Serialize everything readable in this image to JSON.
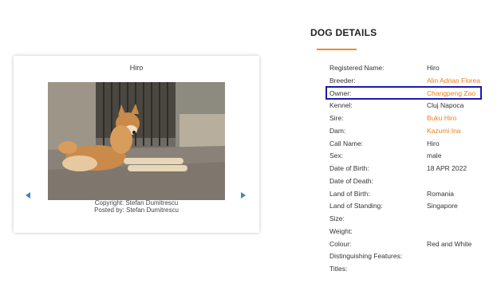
{
  "card": {
    "title": "Hiro",
    "caption_copyright": "Copyright: Stefan Dumitrescu",
    "caption_posted": "Posted by: Stefan Dumitrescu"
  },
  "details": {
    "heading": "DOG DETAILS",
    "rows": [
      {
        "label": "Registered Name:",
        "value": "Hiro",
        "link": false
      },
      {
        "label": "Breeder:",
        "value": "Alin Adrian Florea",
        "link": true
      },
      {
        "label": "Owner:",
        "value": "Changpeng Zao",
        "link": true
      },
      {
        "label": "Kennel:",
        "value": "Cluj Napoca",
        "link": false
      },
      {
        "label": "Sire:",
        "value": "Buku Hiro",
        "link": true
      },
      {
        "label": "Dam:",
        "value": "Kazumi Ina",
        "link": true
      },
      {
        "label": "Call Name:",
        "value": "Hiro",
        "link": false
      },
      {
        "label": "Sex:",
        "value": "male",
        "link": false
      },
      {
        "label": "Date of Birth:",
        "value": "18 APR 2022",
        "link": false
      },
      {
        "label": "Date of Death:",
        "value": "",
        "link": false
      },
      {
        "label": "Land of Birth:",
        "value": "Romania",
        "link": false
      },
      {
        "label": "Land of Standing:",
        "value": "Singapore",
        "link": false
      },
      {
        "label": "Size:",
        "value": "",
        "link": false
      },
      {
        "label": "Weight:",
        "value": "",
        "link": false
      },
      {
        "label": "Colour:",
        "value": "Red and White",
        "link": false
      },
      {
        "label": "Distinguishing Features:",
        "value": "",
        "link": false
      },
      {
        "label": "Titles:",
        "value": "",
        "link": false
      }
    ]
  },
  "colors": {
    "accent": "#f07d1a",
    "highlight_border": "#1a1ab0",
    "arrow": "#3a86c8"
  }
}
